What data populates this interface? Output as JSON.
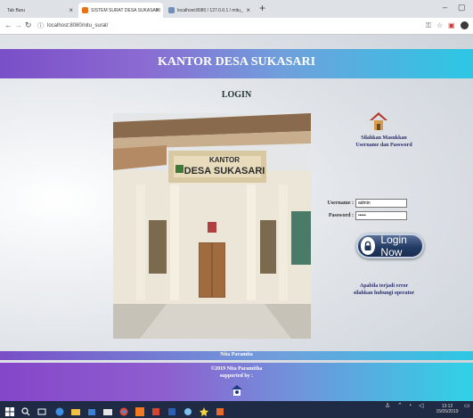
{
  "browser": {
    "tabs": [
      {
        "label": "Tab Baru",
        "active": false,
        "favicon_color": "#7a7a7a"
      },
      {
        "label": "SISTEM SURAT DESA SUKASARI",
        "active": true,
        "favicon_color": "#e8711a"
      },
      {
        "label": "localhost:8080 / 127.0.0.1 / mitu_",
        "active": false,
        "favicon_color": "#6f8fbf"
      }
    ],
    "new_tab": "+",
    "url": "localhost:8080/nitu_surat/",
    "window_controls": {
      "minimize": "–",
      "maximize": "▢"
    }
  },
  "page": {
    "header_title": "KANTOR DESA SUKASARI",
    "login_title": "LOGIN",
    "photo_sign_line1": "KANTOR",
    "photo_sign_line2": "DESA SUKASARI",
    "side": {
      "message_line1": "Silahkan Masukkan",
      "message_line2": "Username dan Password",
      "username_label": "Username :",
      "username_value": "admin",
      "password_label": "Password :",
      "password_value": "•••••",
      "login_button": "Login Now",
      "error_line1": "Apabila terjadi error",
      "error_line2": "silahkan hubungi operator"
    },
    "strip_text": "Nita Paramita",
    "footer_line1": "©2019 Nita Paramitha",
    "footer_line2": "supported by :"
  },
  "taskbar": {
    "time": "13:12",
    "date": "15/05/2019"
  },
  "colors": {
    "header_gradient_start": "#7a4fc7",
    "header_gradient_end": "#2cc7e4",
    "taskbar_bg": "#1f2a44",
    "button_bg": "#233c66"
  }
}
